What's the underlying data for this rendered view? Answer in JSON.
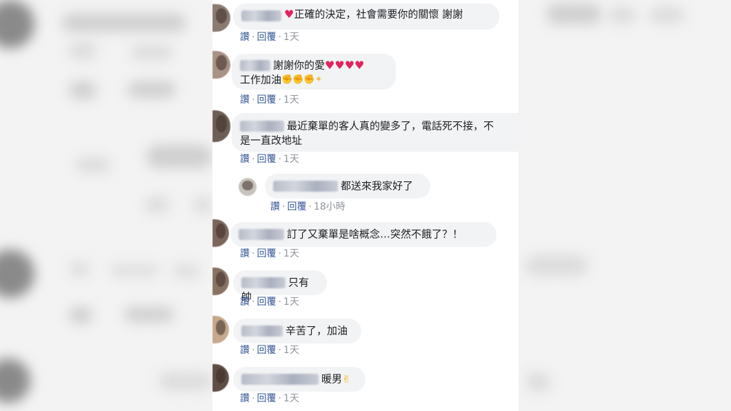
{
  "comments": [
    {
      "text": "正確的決定，社會需要你的關懷 謝謝",
      "like": "讚",
      "reply": "回覆",
      "sep": "·",
      "time": "1天"
    },
    {
      "text": "謝謝你的愛",
      "text2": "工作加油",
      "like": "讚",
      "reply": "回覆",
      "sep": "·",
      "time": "1天"
    },
    {
      "text": "最近棄單的客人真的變多了，電話死不接，不",
      "text2": "是一直改地址",
      "like": "讚",
      "reply": "回覆",
      "sep": "·",
      "time": "1天"
    },
    {
      "text": "都送來我家好了",
      "like": "讚",
      "reply": "回覆",
      "sep": "·",
      "time": "18小時"
    },
    {
      "text": "訂了又棄單是啥概念…突然不餓了？！",
      "like": "讚",
      "reply": "回覆",
      "sep": "·",
      "time": "1天"
    },
    {
      "text": "只有帥",
      "like": "讚",
      "reply": "回覆",
      "sep": "·",
      "time": "1天"
    },
    {
      "text": "辛苦了，加油",
      "like": "讚",
      "reply": "回覆",
      "sep": "·",
      "time": "1天"
    },
    {
      "text": "暖男",
      "like": "讚",
      "reply": "回覆",
      "sep": "·",
      "time": "1天"
    }
  ],
  "icons": {
    "heart": "heart-icon",
    "muscle": "flexed-biceps-icon",
    "sparkles": "sparkles-icon",
    "thumb": "thumbs-up-icon"
  },
  "colors": {
    "bubble": "#f2f3f5",
    "link": "#385898",
    "timestamp": "#90949c",
    "heart": "#e0245e"
  }
}
